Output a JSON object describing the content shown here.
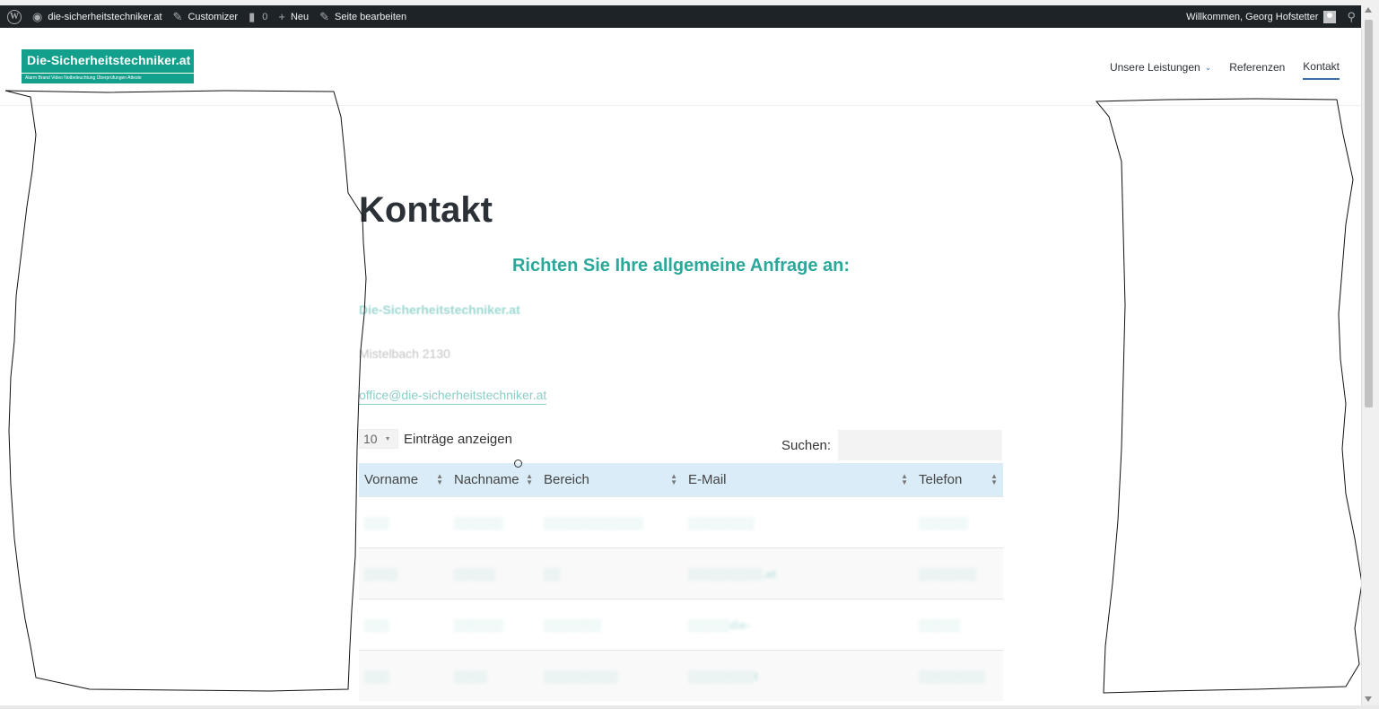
{
  "adminbar": {
    "site_name": "die-sicherheitstechniker.at",
    "customizer": "Customizer",
    "comments_count": "0",
    "new_label": "Neu",
    "edit_page": "Seite bearbeiten",
    "greeting": "Willkommen, Georg Hofstetter"
  },
  "header": {
    "logo_main": "Die-Sicherheitstechniker.at",
    "logo_sub": "Alarm  Brand  Video  Notbeleuchtung  Überprüfungen  Atteste",
    "nav": {
      "services": "Unsere Leistungen",
      "references": "Referenzen",
      "contact": "Kontakt"
    }
  },
  "content": {
    "title": "Kontakt",
    "subheading": "Richten Sie Ihre allgemeine Anfrage an:",
    "company": "Die-Sicherheitstechniker.at",
    "address": "Mistelbach 2130",
    "email": "office@die-sicherheitstechniker.at"
  },
  "table": {
    "length_value": "10",
    "length_label": "Einträge anzeigen",
    "search_label": "Suchen:",
    "columns": [
      "Vorname",
      "Nachname",
      "Bereich",
      "E-Mail",
      "Telefon"
    ],
    "rows": [
      [
        "▒▒▒",
        "▒▒▒▒▒▒",
        "▒▒▒▒▒▒▒▒▒▒▒▒",
        "▒▒▒▒▒▒▒▒",
        "▒▒▒▒▒▒"
      ],
      [
        "▒▒▒▒",
        "▒▒▒▒▒",
        "▒▒",
        "▒▒▒▒▒▒▒▒▒.at",
        "▒▒▒▒▒▒▒"
      ],
      [
        "▒▒▒",
        "▒▒▒▒▒▒",
        "▒▒▒▒▒▒▒",
        "▒▒▒▒▒die-",
        "▒▒▒▒▒"
      ],
      [
        "▒▒▒",
        "▒▒▒▒",
        "▒▒▒▒▒▒▒▒▒",
        "▒▒▒▒▒▒▒▒t",
        "▒▒▒▒▒▒▒▒"
      ]
    ]
  },
  "colors": {
    "accent": "#2aa89a",
    "adminbar_bg": "#1d2327",
    "table_header": "#d9ecf7",
    "title": "#2c3138"
  }
}
